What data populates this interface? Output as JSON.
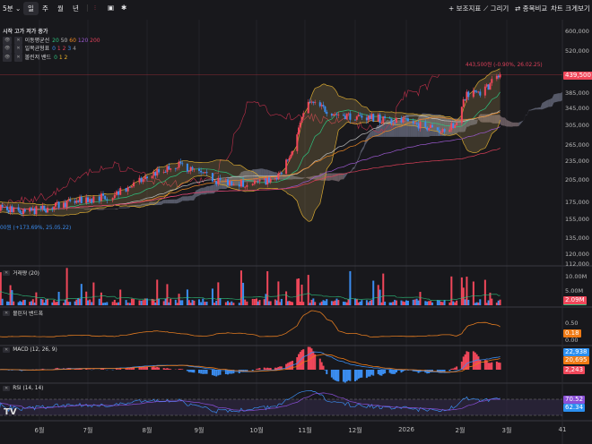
{
  "toolbar": {
    "interval": "5분",
    "periods": [
      "일",
      "주",
      "월",
      "년"
    ],
    "active_period": "일",
    "right_buttons": [
      "+ 보조지표",
      "⟋ 그리기",
      "⇄ 종목비교",
      "차트 크게보기 ⤢"
    ]
  },
  "legend": {
    "header": "시작 고가 저가 종가",
    "items": [
      {
        "name": "이동평균선",
        "params": [
          "20",
          "50",
          "60",
          "120",
          "200"
        ],
        "colors": [
          "#2ec27e",
          "#bfbfbf",
          "#f08a24",
          "#9b59d0",
          "#e0405a"
        ]
      },
      {
        "name": "일목균형표",
        "params": [
          "0",
          "1",
          "2",
          "3",
          "4"
        ],
        "colors": [
          "#3b8df0",
          "#e0405a",
          "#e0405a",
          "#3b8df0",
          "#999999"
        ]
      },
      {
        "name": "볼린저 밴드",
        "params": [
          "0",
          "1",
          "2"
        ],
        "colors": [
          "#2ec27e",
          "#f0b429",
          "#f0b429"
        ]
      }
    ]
  },
  "price_axis": {
    "ticks": [
      "600,000",
      "520,000",
      "385,000",
      "345,000",
      "305,000",
      "265,000",
      "235,000",
      "205,000",
      "175,000",
      "155,000",
      "135,000",
      "120,000",
      "112,000"
    ],
    "current_price": "439,500",
    "high_annotation": "443,500원 (-0.90%, 26.02.25)",
    "low_annotation": "00원 (+173.69%, 25.05.22)"
  },
  "panels": {
    "volume": {
      "title": "거래량 (20)",
      "ticks": [
        "10.00M",
        "5.00M"
      ],
      "value": "2.09M"
    },
    "bb_width": {
      "title": "볼린저 밴드폭",
      "ticks": [
        "0.50",
        "0.00"
      ],
      "value": "0.18"
    },
    "macd": {
      "title": "MACD (12, 26, 9)",
      "values": [
        "22,938",
        "20,695",
        "2,243"
      ]
    },
    "rsi": {
      "title": "RSI (14, 14)",
      "values": [
        "70.52",
        "62.34"
      ]
    }
  },
  "x_axis": {
    "labels": [
      "6월",
      "7월",
      "8월",
      "9월",
      "10월",
      "11월",
      "12월",
      "2026",
      "2월",
      "3월",
      "41"
    ]
  },
  "colors": {
    "up": "#f0475a",
    "down": "#3b8df0",
    "background": "#18181c"
  },
  "chart_data": {
    "type": "candlestick",
    "scale": "log",
    "ylim": [
      112000,
      600000
    ],
    "close_path": [
      [
        "2025-05-01",
        172000
      ],
      [
        "2025-05-22",
        162000
      ],
      [
        "2025-06-15",
        172000
      ],
      [
        "2025-07-15",
        185000
      ],
      [
        "2025-08-05",
        215000
      ],
      [
        "2025-08-20",
        230000
      ],
      [
        "2025-09-10",
        205000
      ],
      [
        "2025-09-30",
        200000
      ],
      [
        "2025-10-15",
        210000
      ],
      [
        "2025-10-25",
        265000
      ],
      [
        "2025-11-03",
        360000
      ],
      [
        "2025-11-20",
        330000
      ],
      [
        "2025-12-15",
        320000
      ],
      [
        "2026-01-05",
        310000
      ],
      [
        "2026-01-20",
        295000
      ],
      [
        "2026-01-30",
        310000
      ],
      [
        "2026-02-05",
        385000
      ],
      [
        "2026-02-15",
        390000
      ],
      [
        "2026-02-25",
        439500
      ]
    ]
  }
}
